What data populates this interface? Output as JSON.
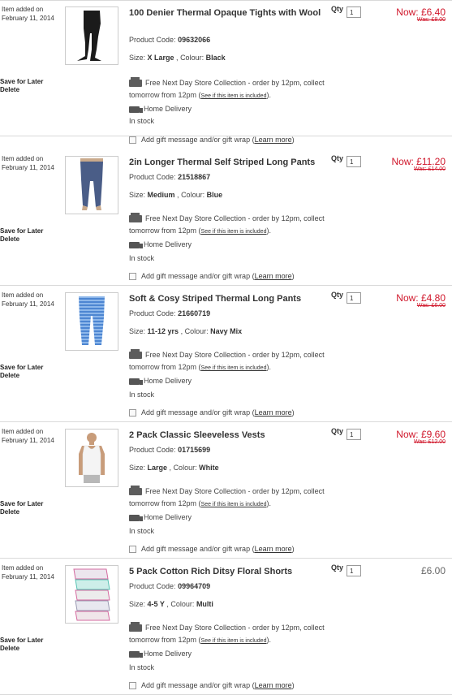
{
  "common": {
    "added_label": "Item added on",
    "added_date": "February 11, 2014",
    "save_label": "Save for Later",
    "delete_label": "Delete",
    "code_label": "Product Code:",
    "size_label": "Size:",
    "colour_label": "Colour:",
    "collect_line1": "Free Next Day Store Collection - order by 12pm, collect",
    "collect_line2": "tomorrow from 12pm",
    "collect_link": "See if this item is included",
    "delivery_label": "Home Delivery",
    "stock_label": "In stock",
    "gift_label": "Add gift message and/or gift wrap",
    "learn_more": "Learn more",
    "qty_label": "Qty",
    "store_icon_text": "M&S"
  },
  "items": [
    {
      "title": "100 Denier Thermal Opaque Tights with Wool",
      "code": "09632066",
      "size": "X Large",
      "colour": "Black",
      "qty": "1",
      "now": "Now: £6.40",
      "was": "Was: £8.00"
    },
    {
      "title": "2in Longer Thermal Self Striped Long Pants",
      "code": "21518867",
      "size": "Medium",
      "colour": "Blue",
      "qty": "1",
      "now": "Now: £11.20",
      "was": "Was: £14.00"
    },
    {
      "title": "Soft & Cosy Striped Thermal Long Pants",
      "code": "21660719",
      "size": "11-12 yrs",
      "colour": "Navy Mix",
      "qty": "1",
      "now": "Now: £4.80",
      "was": "Was: £6.00"
    },
    {
      "title": "2 Pack Classic Sleeveless Vests",
      "code": "01715699",
      "size": "Large",
      "colour": "White",
      "qty": "1",
      "now": "Now: £9.60",
      "was": "Was: £12.00"
    },
    {
      "title": "5 Pack Cotton Rich Ditsy Floral Shorts",
      "code": "09964709",
      "size": "4-5 Y",
      "colour": "Multi",
      "qty": "1",
      "price": "£6.00"
    }
  ],
  "colors": {
    "sale_red": "#d0162a",
    "divider": "#d9d9d9"
  }
}
